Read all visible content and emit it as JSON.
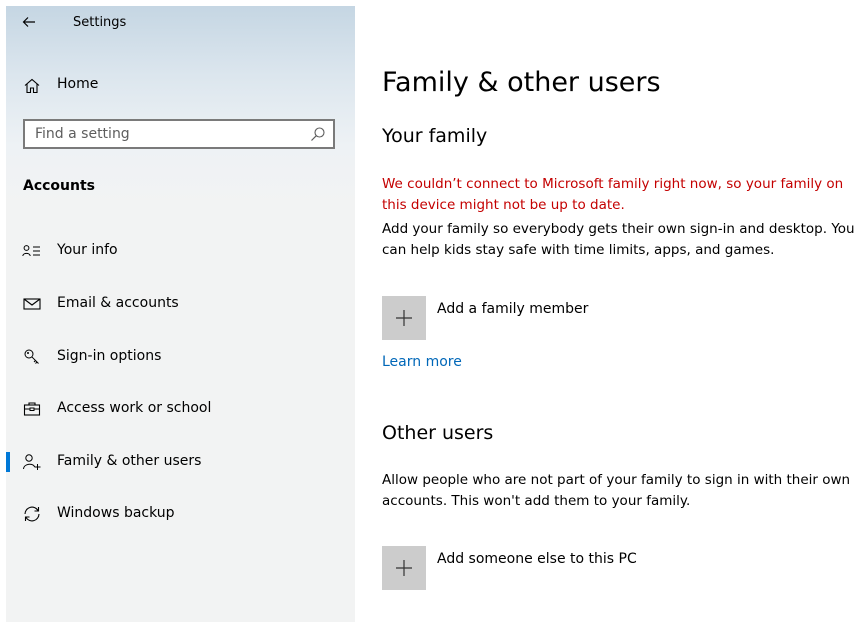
{
  "window": {
    "title": "Settings"
  },
  "sidebar": {
    "home_label": "Home",
    "search": {
      "placeholder": "Find a setting",
      "value": ""
    },
    "section_label": "Accounts",
    "items": [
      {
        "label": "Your info",
        "icon": "person-list-icon",
        "active": false
      },
      {
        "label": "Email & accounts",
        "icon": "mail-icon",
        "active": false
      },
      {
        "label": "Sign-in options",
        "icon": "key-icon",
        "active": false
      },
      {
        "label": "Access work or school",
        "icon": "briefcase-icon",
        "active": false
      },
      {
        "label": "Family & other users",
        "icon": "person-add-icon",
        "active": true
      },
      {
        "label": "Windows backup",
        "icon": "sync-icon",
        "active": false
      }
    ]
  },
  "main": {
    "title": "Family & other users",
    "family": {
      "heading": "Your family",
      "error": "We couldn’t connect to Microsoft family right now, so your family on this device might not be up to date.",
      "description": "Add your family so everybody gets their own sign-in and desktop. You can help kids stay safe with time limits, apps, and games.",
      "add_label": "Add a family member",
      "learn_more": "Learn more"
    },
    "other_users": {
      "heading": "Other users",
      "description": "Allow people who are not part of your family to sign in with their own accounts. This won't add them to your family.",
      "add_label": "Add someone else to this PC"
    }
  },
  "colors": {
    "accent": "#0078d7",
    "link": "#0067b8",
    "error": "#c40000",
    "tile": "#cccccc"
  }
}
